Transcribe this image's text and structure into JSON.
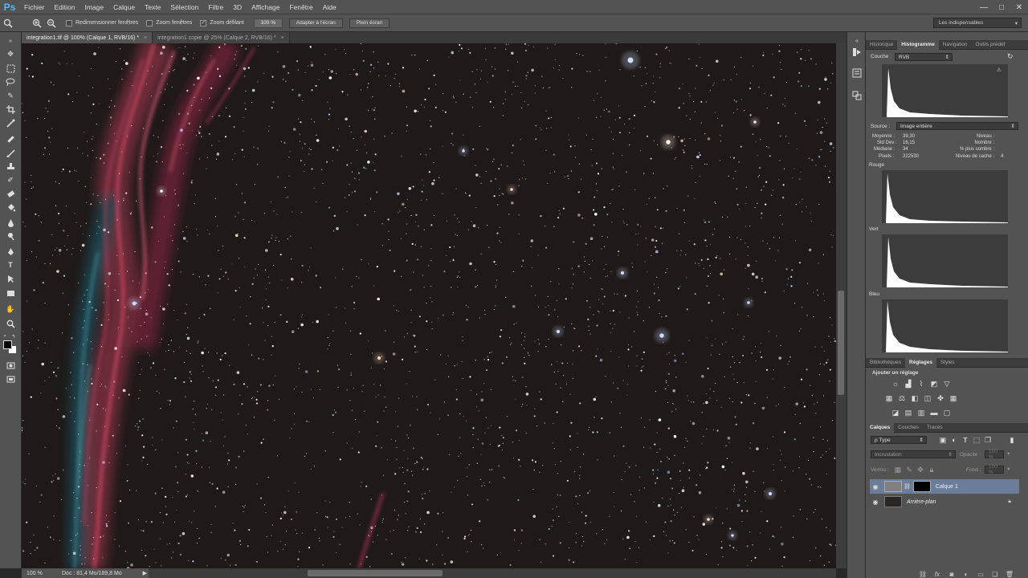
{
  "app": {
    "logo": "Ps"
  },
  "menu": [
    "Fichier",
    "Edition",
    "Image",
    "Calque",
    "Texte",
    "Sélection",
    "Filtre",
    "3D",
    "Affichage",
    "Fenêtre",
    "Aide"
  ],
  "window_controls": {
    "minimize": "—",
    "maximize": "□",
    "close": "✕"
  },
  "options": {
    "resize_windows": "Redimensionner fenêtres",
    "zoom_windows": "Zoom fenêtres",
    "scrubby_zoom": "Zoom défilant",
    "zoom_value": "100 %",
    "fit_screen": "Adapter à l'écran",
    "full_screen": "Plein écran",
    "workspace": "Les indispensables"
  },
  "tabs": [
    {
      "label": "integration1.tif @ 100% (Calque 1, RVB/16) *",
      "close": "×"
    },
    {
      "label": "integration1 copie @ 25% (Calque 2, RVB/16) *",
      "close": "×"
    }
  ],
  "status": {
    "zoom": "100 %",
    "doc": "Doc : 81,4 Mo/189,8 Mo",
    "arrow": "▶"
  },
  "histogram_panel": {
    "tabs": [
      "Historique",
      "Histogramme",
      "Navigation",
      "Outils prédéf"
    ],
    "channel_label": "Couche :",
    "channel_value": "RVB",
    "source_label": "Source :",
    "source_value": "Image entière",
    "stats_left": [
      {
        "label": "Moyenne :",
        "value": "39,30"
      },
      {
        "label": "Std Dev :",
        "value": "16,15"
      },
      {
        "label": "Médiane :",
        "value": "34"
      },
      {
        "label": "Pixels :",
        "value": "222530"
      }
    ],
    "stats_right": [
      {
        "label": "Niveau :",
        "value": ""
      },
      {
        "label": "Nombre :",
        "value": ""
      },
      {
        "label": "% plus sombre :",
        "value": ""
      },
      {
        "label": "Niveau de cache :",
        "value": "4"
      }
    ],
    "channels": [
      "Rouge",
      "Vert",
      "Bleu"
    ]
  },
  "adjust_panel": {
    "tabs": [
      "Bibliothèques",
      "Réglages",
      "Styles"
    ],
    "title": "Ajouter un réglage"
  },
  "layers_panel": {
    "tabs": [
      "Calques",
      "Couches",
      "Tracés"
    ],
    "filter": "ρ Type",
    "blend_mode": "Incrustation",
    "opacity_label": "Opacité :",
    "opacity_value": "100 %",
    "lock_label": "Verrou :",
    "fill_label": "Fond :",
    "fill_value": "100 %",
    "layers": [
      {
        "name": "Calque 1",
        "selected": true
      },
      {
        "name": "Arrière-plan",
        "selected": false
      }
    ]
  }
}
